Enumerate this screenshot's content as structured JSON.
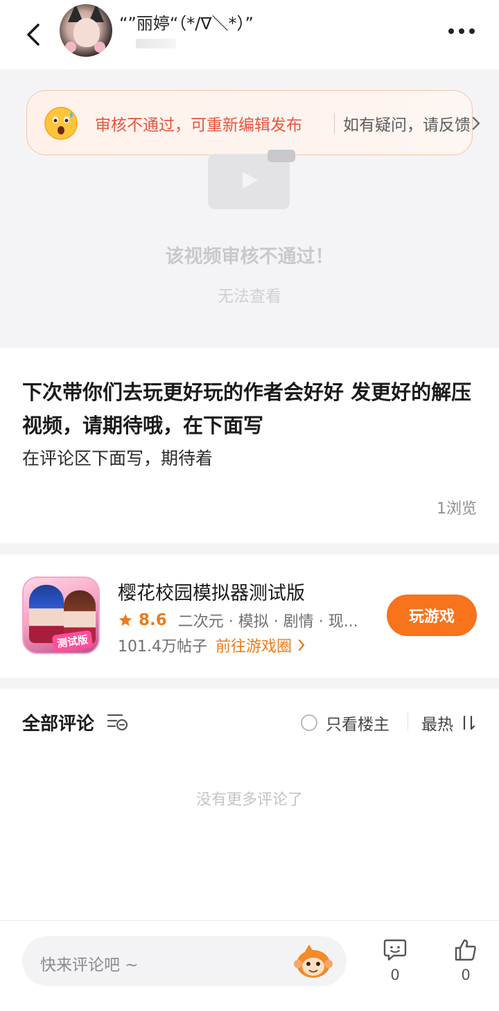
{
  "header": {
    "username": "“”丽婷“（*/∇＼*）”",
    "back_icon": "chevron-left-icon",
    "more_icon": "more-dots-icon"
  },
  "notice": {
    "message": "审核不通过，可重新编辑发布",
    "feedback": "如有疑问，请反馈",
    "emoji": "shocked-face-icon",
    "text_color": "#e8553d"
  },
  "video": {
    "error_title": "该视频审核不通过！",
    "error_subtitle": "无法查看"
  },
  "post": {
    "title": "下次带你们去玩更好玩的作者会好好 发更好的解压视频，请期待哦，在下面写",
    "body": "在评论区下面写，期待着",
    "views": "1浏览"
  },
  "game": {
    "name": "樱花校园模拟器测试版",
    "icon_tag": "测试版",
    "score": "8.6",
    "tags": "二次元 · 模拟 · 剧情 · 现...",
    "posts": "101.4万帖子",
    "link": "前往游戏圈",
    "play_button": "玩游戏",
    "accent_color": "#f7731c"
  },
  "comments": {
    "title": "全部评论",
    "op_only": "只看楼主",
    "sort": "最热",
    "empty": "没有更多评论了"
  },
  "bottom_bar": {
    "placeholder": "快来评论吧 ~",
    "comment_count": "0",
    "like_count": "0"
  }
}
